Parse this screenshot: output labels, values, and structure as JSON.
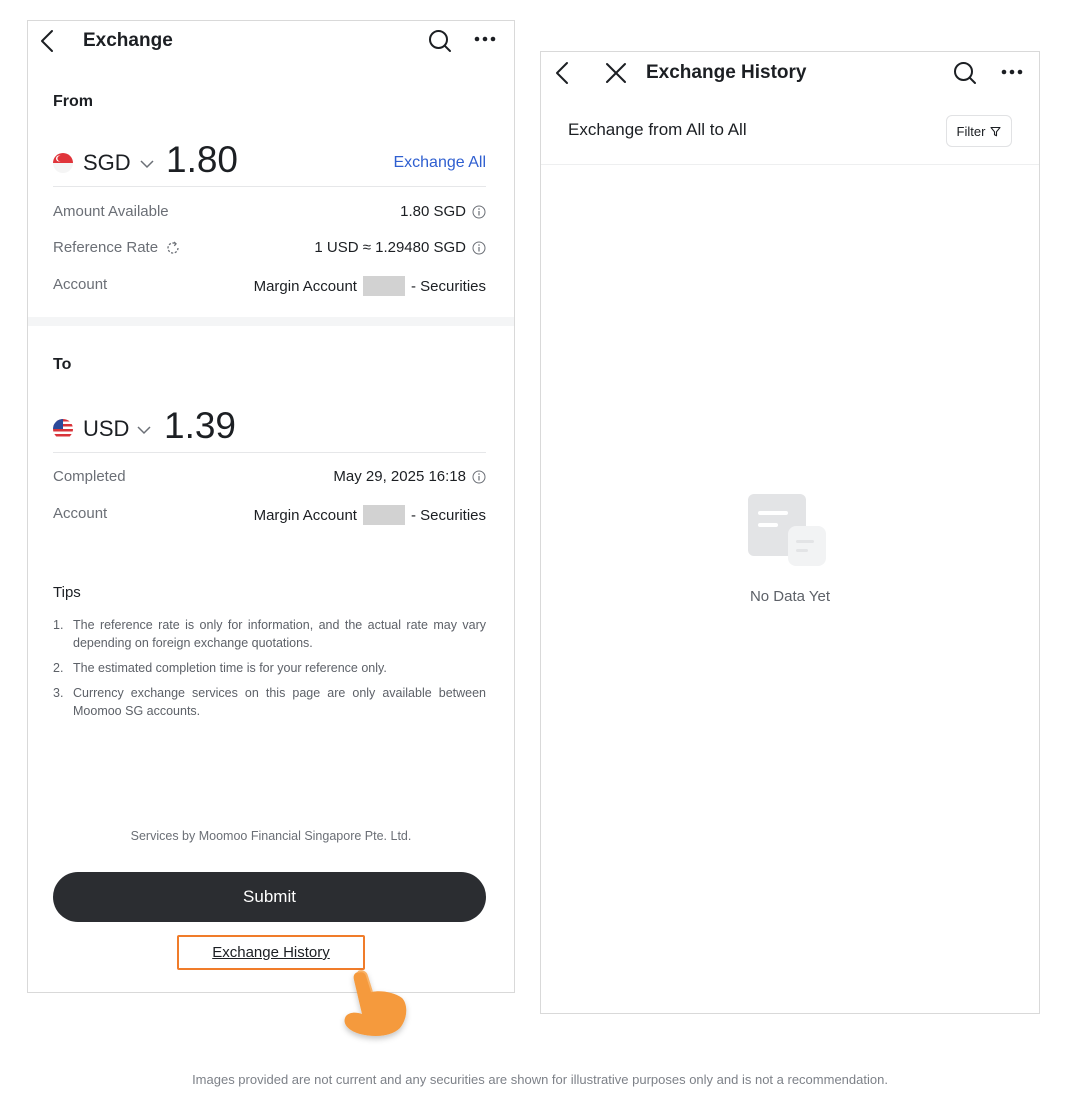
{
  "exchange_screen": {
    "title": "Exchange",
    "from": {
      "section_label": "From",
      "currency": "SGD",
      "amount": "1.80",
      "exchange_all_label": "Exchange All",
      "amount_available_label": "Amount Available",
      "amount_available_value": "1.80 SGD",
      "reference_rate_label": "Reference Rate",
      "reference_rate_value": "1 USD ≈ 1.29480 SGD",
      "account_label": "Account",
      "account_name": "Margin Account",
      "account_suffix": "- Securities"
    },
    "to": {
      "section_label": "To",
      "currency": "USD",
      "amount": "1.39",
      "completed_label": "Completed",
      "completed_value": "May 29, 2025 16:18",
      "account_label": "Account",
      "account_name": "Margin Account",
      "account_suffix": "- Securities"
    },
    "tips": {
      "title": "Tips",
      "items": [
        {
          "num": "1.",
          "text": "The reference rate is only for information, and the actual rate may vary depending on foreign exchange quotations."
        },
        {
          "num": "2.",
          "text": "The estimated completion time is for your reference only."
        },
        {
          "num": "3.",
          "text": "Currency exchange services on this page are only available between Moomoo SG accounts."
        }
      ]
    },
    "footer_note": "Services by Moomoo Financial Singapore Pte. Ltd.",
    "submit_label": "Submit",
    "history_link_label": "Exchange History"
  },
  "history_screen": {
    "title": "Exchange History",
    "subheader": "Exchange from All to All",
    "filter_label": "Filter",
    "empty_text": "No Data Yet"
  },
  "disclaimer": "Images provided are not current and any securities are shown for illustrative purposes only and is not a recommendation.",
  "colors": {
    "accent_link": "#2f5fd0",
    "submit_bg": "#2b2d31",
    "highlight": "#f07c2a"
  },
  "icons": [
    "back-icon",
    "close-icon",
    "search-icon",
    "more-icon",
    "info-icon",
    "refresh-icon",
    "chevron-down-icon",
    "filter-icon",
    "singapore-flag-icon",
    "us-flag-icon",
    "empty-document-icon",
    "pointing-hand-icon"
  ]
}
